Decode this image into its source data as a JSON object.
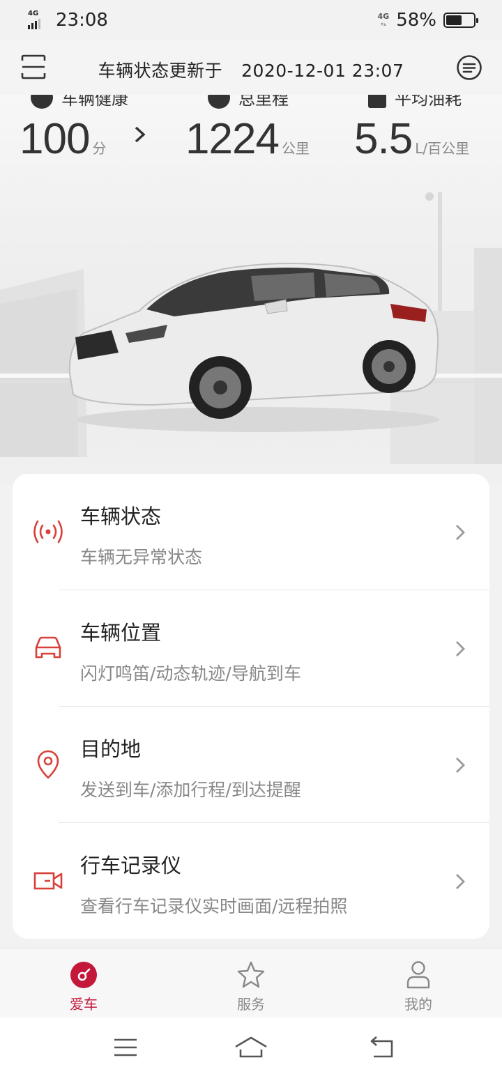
{
  "status_bar": {
    "time": "23:08",
    "network_left": "4G",
    "network_right": "4G",
    "battery_percent": "58%",
    "battery_level": 0.58
  },
  "header": {
    "update_label": "车辆状态更新于",
    "update_time": "2020-12-01 23:07"
  },
  "stats": [
    {
      "label": "车辆健康",
      "value": "100",
      "unit": "分"
    },
    {
      "label": "总里程",
      "value": "1224",
      "unit": "公里"
    },
    {
      "label": "平均油耗",
      "value": "5.5",
      "unit": "L/百公里"
    }
  ],
  "menu_items": [
    {
      "title": "车辆状态",
      "subtitle": "车辆无异常状态",
      "icon": "signal-broadcast-icon"
    },
    {
      "title": "车辆位置",
      "subtitle": "闪灯鸣笛/动态轨迹/导航到车",
      "icon": "car-icon"
    },
    {
      "title": "目的地",
      "subtitle": "发送到车/添加行程/到达提醒",
      "icon": "location-pin-icon"
    },
    {
      "title": "行车记录仪",
      "subtitle": "查看行车记录仪实时画面/远程拍照",
      "icon": "dashcam-icon"
    }
  ],
  "tabs": [
    {
      "label": "爱车",
      "icon": "car-gauge-icon",
      "active": true
    },
    {
      "label": "服务",
      "icon": "star-icon",
      "active": false
    },
    {
      "label": "我的",
      "icon": "person-icon",
      "active": false
    }
  ],
  "colors": {
    "accent": "#c3183a",
    "icon_red": "#d9403a",
    "text_primary": "#222222",
    "text_secondary": "#888888"
  }
}
